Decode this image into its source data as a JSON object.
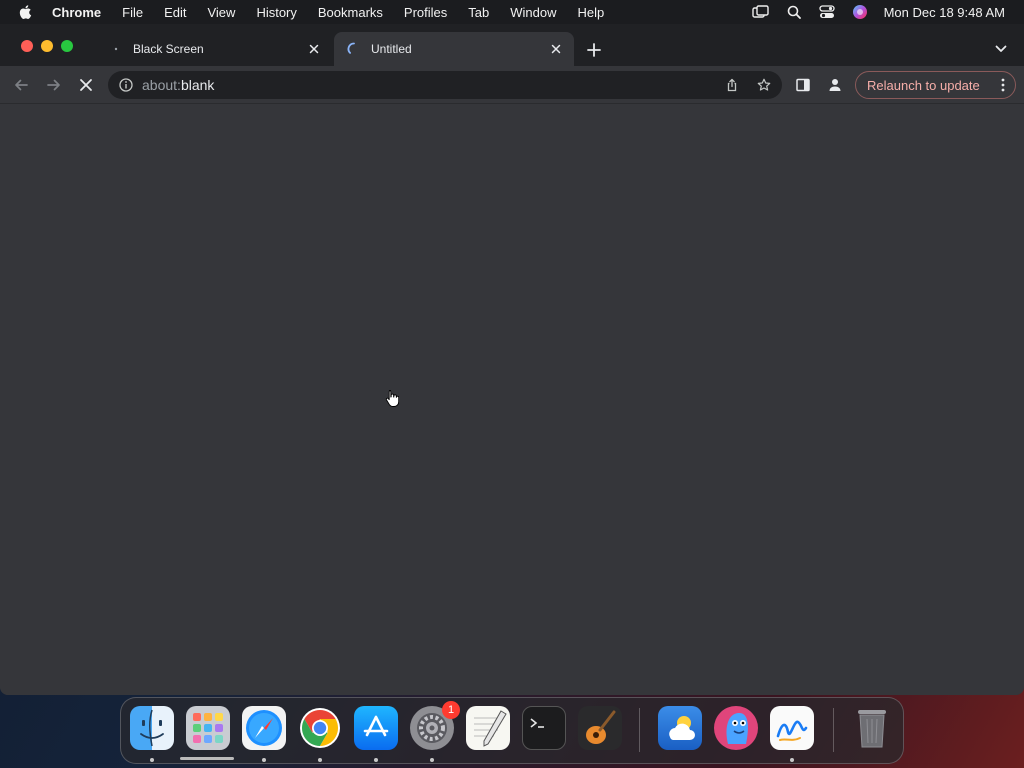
{
  "menubar": {
    "app_name": "Chrome",
    "items": [
      "File",
      "Edit",
      "View",
      "History",
      "Bookmarks",
      "Profiles",
      "Tab",
      "Window",
      "Help"
    ],
    "clock": "Mon Dec 18  9:48 AM"
  },
  "tabs": [
    {
      "title": "Black Screen",
      "active": false
    },
    {
      "title": "Untitled",
      "active": true,
      "loading": true
    }
  ],
  "toolbar": {
    "url_prefix": "about:",
    "url_host": "blank",
    "relaunch_label": "Relaunch to update"
  },
  "dock": {
    "apps": [
      "Finder",
      "Launchpad",
      "Safari",
      "Google Chrome",
      "App Store",
      "System Settings",
      "TextEdit",
      "Terminal",
      "GarageBand",
      "Weather",
      "Fonts",
      "Freeform",
      "Trash"
    ],
    "system_settings_badge": "1"
  },
  "colors": {
    "chrome_frame": "#202124",
    "toolbar": "#35363a",
    "relaunch_text": "#f6aea9",
    "close_red": "#ff5f57",
    "minimize_yellow": "#febc2e",
    "zoom_green": "#28c840"
  }
}
